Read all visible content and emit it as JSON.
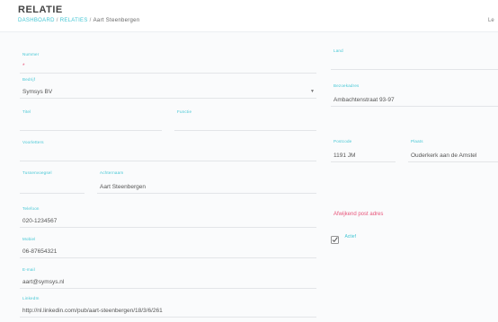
{
  "header": {
    "title": "RELATIE",
    "breadcrumb": {
      "dashboard": "DASHBOARD",
      "relaties": "RELATIES",
      "current": "Aart Steenbergen"
    },
    "right_text": "Le"
  },
  "form": {
    "nummer": {
      "label": "Nummer",
      "value": "*"
    },
    "bedrijf": {
      "label": "Bedrijf",
      "value": "Symsys BV"
    },
    "titel": {
      "label": "Titel",
      "value": ""
    },
    "functie": {
      "label": "Functie",
      "value": ""
    },
    "voorletters": {
      "label": "Voorletters",
      "value": ""
    },
    "tussenvoegsel": {
      "label": "Tussenvoegsel",
      "value": ""
    },
    "achternaam": {
      "label": "Achternaam",
      "value": "Aart Steenbergen"
    },
    "telefoon": {
      "label": "Telefoon",
      "value": "020-1234567"
    },
    "mobiel": {
      "label": "Mobiel",
      "value": "06-87654321"
    },
    "email": {
      "label": "E-mail",
      "value": "aart@symsys.nl"
    },
    "linkedin": {
      "label": "LinkedIn",
      "value": "http://nl.linkedin.com/pub/aart-steenbergen/18/3/6/261"
    },
    "land": {
      "label": "Land",
      "value": ""
    },
    "bezoekadres": {
      "label": "Bezoekadres",
      "value": "Ambachtenstraat 93-97"
    },
    "postcode": {
      "label": "Postcode",
      "value": "1191 JM"
    },
    "plaats": {
      "label": "Plaats",
      "value": "Ouderkerk aan de Amstel"
    }
  },
  "warning_text": "Afwijkend post adres",
  "checkbox": {
    "label": "Actief",
    "checked": true
  },
  "colors": {
    "accent": "#43c6d4",
    "alert": "#e8557a"
  }
}
